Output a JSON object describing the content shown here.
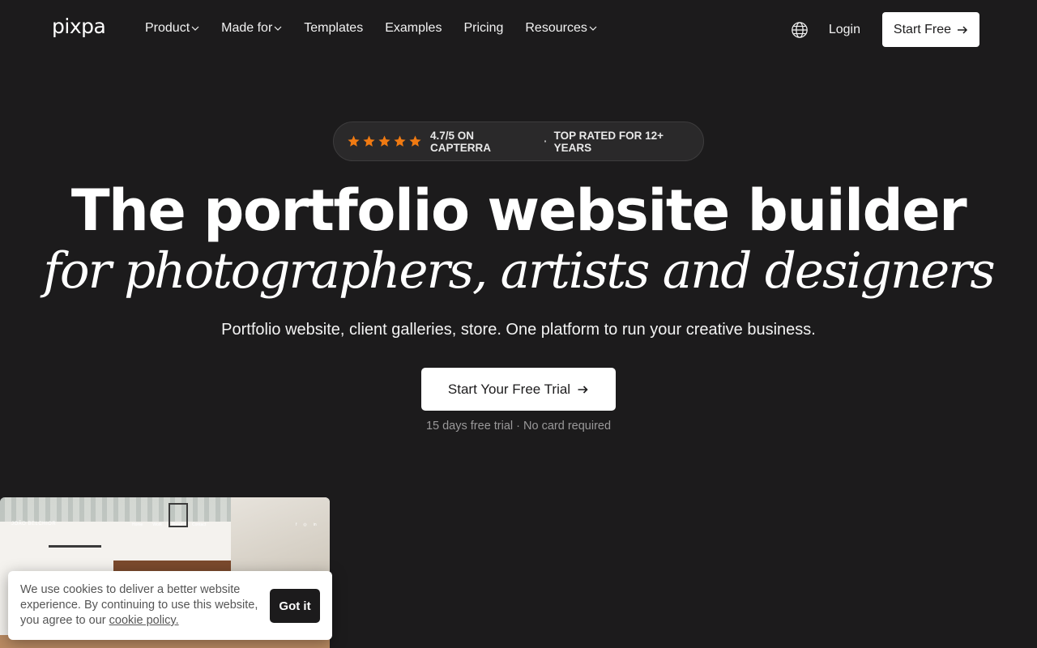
{
  "nav": {
    "logo": "pixpa",
    "items": [
      {
        "label": "Product",
        "dropdown": true
      },
      {
        "label": "Made for",
        "dropdown": true
      },
      {
        "label": "Templates",
        "dropdown": false
      },
      {
        "label": "Examples",
        "dropdown": false
      },
      {
        "label": "Pricing",
        "dropdown": false
      },
      {
        "label": "Resources",
        "dropdown": true
      }
    ],
    "login": "Login",
    "start_free": "Start Free"
  },
  "badge": {
    "stars": 5,
    "rating": "4.7/5 ON CAPTERRA",
    "separator": "·",
    "tagline": "TOP RATED FOR 12+ YEARS",
    "star_color": "#f07a12"
  },
  "hero": {
    "title": "The portfolio website builder",
    "subtitle": "for photographers, artists and designers",
    "description": "Portfolio website, client galleries, store. One platform to run your creative business.",
    "cta": "Start Your Free Trial",
    "note": "15 days free trial · No card required"
  },
  "preview": {
    "site_name": "JOÃO BELCHIOR",
    "menu": [
      "Home",
      "Work",
      "About",
      "Contact"
    ],
    "social": [
      "f",
      "◎",
      "in"
    ]
  },
  "cookie": {
    "text": "We use cookies to deliver a better website experience. By continuing to use this website, you agree to our ",
    "link": "cookie policy.",
    "button": "Got it"
  },
  "colors": {
    "background": "#1c1b1c",
    "accent": "#ffffff"
  }
}
